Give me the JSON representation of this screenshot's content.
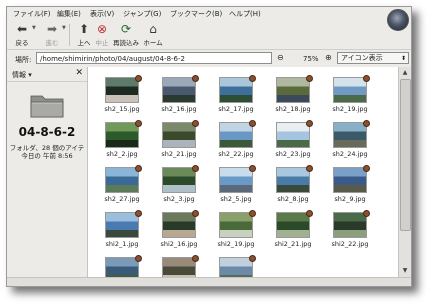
{
  "menu": [
    "ファイル(F)",
    "編集(E)",
    "表示(V)",
    "ジャンプ(G)",
    "ブックマーク(B)",
    "ヘルプ(H)"
  ],
  "toolbar": {
    "back": "戻る",
    "forward": "進む",
    "up": "上へ",
    "stop": "中止",
    "reload": "再読込み",
    "home": "ホーム"
  },
  "location": {
    "label": "場所:",
    "path": "/home/shimirin/photo/04/august/04-8-6-2",
    "zoom": "75%",
    "view_mode": "アイコン表示"
  },
  "sidebar": {
    "title": "情報",
    "folder_name": "04-8-6-2",
    "info_line1": "フォルダ、28 個のアイテ",
    "info_line2": "今日の 午前 8:56"
  },
  "files": [
    {
      "name": "sh2_15.jpg",
      "colors": [
        "#1c2a20",
        "#5d7a6a",
        "#c9c2b8"
      ]
    },
    {
      "name": "sh2_16.jpg",
      "colors": [
        "#4a5a6e",
        "#9aa8b8",
        "#2a3a30"
      ]
    },
    {
      "name": "sh2_17.jpg",
      "colors": [
        "#3e6f9a",
        "#a9c6db",
        "#2d4d34"
      ]
    },
    {
      "name": "sh2_18.jpg",
      "colors": [
        "#5a6a3a",
        "#b0b8a0",
        "#3a4a5a"
      ]
    },
    {
      "name": "sh2_19.jpg",
      "colors": [
        "#6f9ac4",
        "#d4e2ec",
        "#4a6a4a"
      ]
    },
    {
      "name": "sh2_2.jpg",
      "colors": [
        "#2c5a2a",
        "#6f9a5a",
        "#1a2a18"
      ]
    },
    {
      "name": "sh2_21.jpg",
      "colors": [
        "#3a4a2a",
        "#7a8a6a",
        "#aab4bc"
      ]
    },
    {
      "name": "sh2_22.jpg",
      "colors": [
        "#6a98c4",
        "#c0d4e4",
        "#3a5a3a"
      ]
    },
    {
      "name": "sh2_23.jpg",
      "colors": [
        "#a4c4e0",
        "#e8eef2",
        "#4a6a4a"
      ]
    },
    {
      "name": "sh2_24.jpg",
      "colors": [
        "#3a5a6a",
        "#8ab0c8",
        "#6a6a5a"
      ]
    },
    {
      "name": "sh2_27.jpg",
      "colors": [
        "#3a6a98",
        "#8ab4d8",
        "#5a7a5a"
      ]
    },
    {
      "name": "sh2_3.jpg",
      "colors": [
        "#2a4a2a",
        "#6a8a5a",
        "#b0c0c8"
      ]
    },
    {
      "name": "sh2_5.jpg",
      "colors": [
        "#6a9ac8",
        "#c8dcec",
        "#5a6a7a"
      ]
    },
    {
      "name": "sh2_8.jpg",
      "colors": [
        "#4a7aa8",
        "#a8c8e0",
        "#3a4a3a"
      ]
    },
    {
      "name": "sh2_9.jpg",
      "colors": [
        "#3a5a8a",
        "#7aa0c8",
        "#5a5a4a"
      ]
    },
    {
      "name": "shi2_1.jpg",
      "colors": [
        "#4a7ab0",
        "#9abedc",
        "#3a4a3a"
      ]
    },
    {
      "name": "shi2_16.jpg",
      "colors": [
        "#2a3a2a",
        "#6a7a5a",
        "#b8a890"
      ]
    },
    {
      "name": "shi2_19.jpg",
      "colors": [
        "#4a6a3a",
        "#8aa06a",
        "#c8d0c0"
      ]
    },
    {
      "name": "shi2_21.jpg",
      "colors": [
        "#2a4a2a",
        "#5a7a4a",
        "#a0b090"
      ]
    },
    {
      "name": "shi2_22.jpg",
      "colors": [
        "#2a3a2a",
        "#4a6a4a",
        "#8aa07a"
      ]
    },
    {
      "name": "",
      "colors": [
        "#3a5a7a",
        "#7a9ab8",
        "#4a5a3a"
      ]
    },
    {
      "name": "",
      "colors": [
        "#4a4a3a",
        "#9a8a7a",
        "#c8c0b0"
      ]
    },
    {
      "name": "",
      "colors": [
        "#6a8aa8",
        "#c0d0dc",
        "#5a6a5a"
      ]
    }
  ]
}
